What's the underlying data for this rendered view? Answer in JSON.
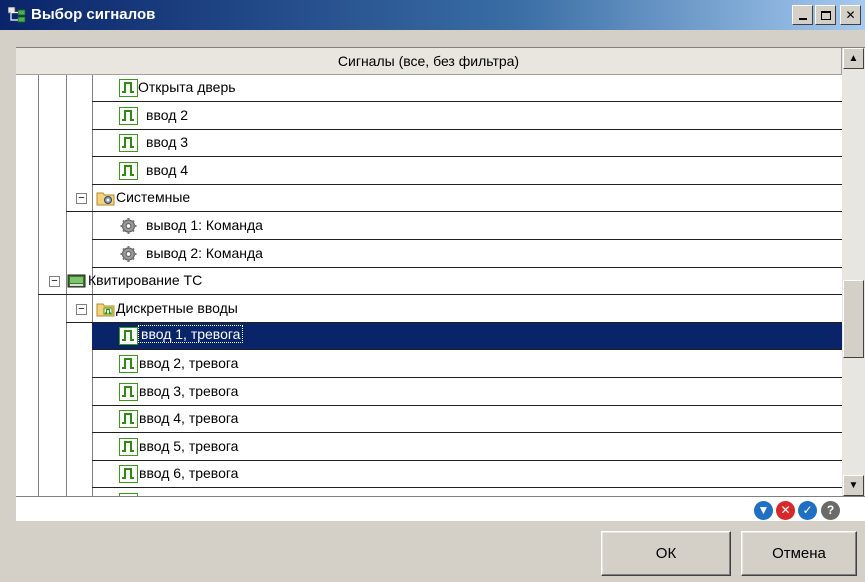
{
  "window": {
    "title": "Выбор сигналов"
  },
  "tree": {
    "header": "Сигналы (все, без фильтра)",
    "rows": [
      {
        "label": "Открыта дверь",
        "icon": "digital-signal-icon"
      },
      {
        "label": "ввод  2",
        "icon": "digital-signal-icon"
      },
      {
        "label": "ввод  3",
        "icon": "digital-signal-icon"
      },
      {
        "label": "ввод  4",
        "icon": "digital-signal-icon"
      },
      {
        "label": "Системные",
        "icon": "system-folder-icon",
        "expander": "−"
      },
      {
        "label": "вывод  1: Команда",
        "icon": "gear-icon"
      },
      {
        "label": "вывод  2: Команда",
        "icon": "gear-icon"
      },
      {
        "label": "Квитирование ТС",
        "icon": "device-icon",
        "expander": "−"
      },
      {
        "label": "Дискретные вводы",
        "icon": "folder-icon",
        "expander": "−"
      },
      {
        "label": "ввод 1, тревога",
        "icon": "digital-signal-icon",
        "selected": true
      },
      {
        "label": "ввод 2, тревога",
        "icon": "digital-signal-icon"
      },
      {
        "label": "ввод 3, тревога",
        "icon": "digital-signal-icon"
      },
      {
        "label": "ввод 4, тревога",
        "icon": "digital-signal-icon"
      },
      {
        "label": "ввод 5, тревога",
        "icon": "digital-signal-icon"
      },
      {
        "label": "ввод 6, тревога",
        "icon": "digital-signal-icon"
      }
    ]
  },
  "filter": {
    "value": "",
    "actions": [
      {
        "name": "filter-icon",
        "color": "#1f6fc5",
        "glyph": "▼"
      },
      {
        "name": "clear-icon",
        "color": "#d62a2a",
        "glyph": "✕"
      },
      {
        "name": "apply-icon",
        "color": "#1f6fc5",
        "glyph": "✓"
      },
      {
        "name": "help-icon",
        "color": "#6a6a6a",
        "glyph": "?"
      }
    ]
  },
  "buttons": {
    "ok": "ОК",
    "cancel": "Отмена"
  },
  "colors": {
    "selection": "#0a246a",
    "signal_icon": "#3a9a1a"
  }
}
